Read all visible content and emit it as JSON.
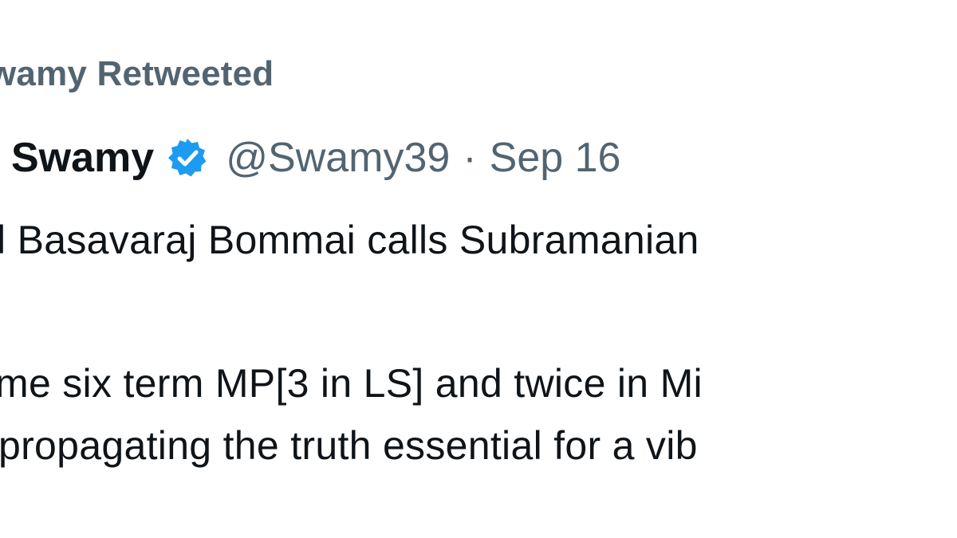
{
  "retweet": {
    "text": "wamy Retweeted"
  },
  "author": {
    "display_name": "Swamy",
    "verified_icon": "verified-badge-icon",
    "handle": "@Swamy39",
    "separator": "·",
    "date": "Sep 16"
  },
  "tweet": {
    "line1": "l Basavaraj Bommai calls Subramanian",
    "line2": "me six term MP[3 in LS] and twice in Mi",
    "line3": "propagating the truth essential for a vib"
  },
  "colors": {
    "primary_text": "#0f1419",
    "secondary_text": "#536471",
    "verified_blue": "#1d9bf0"
  }
}
